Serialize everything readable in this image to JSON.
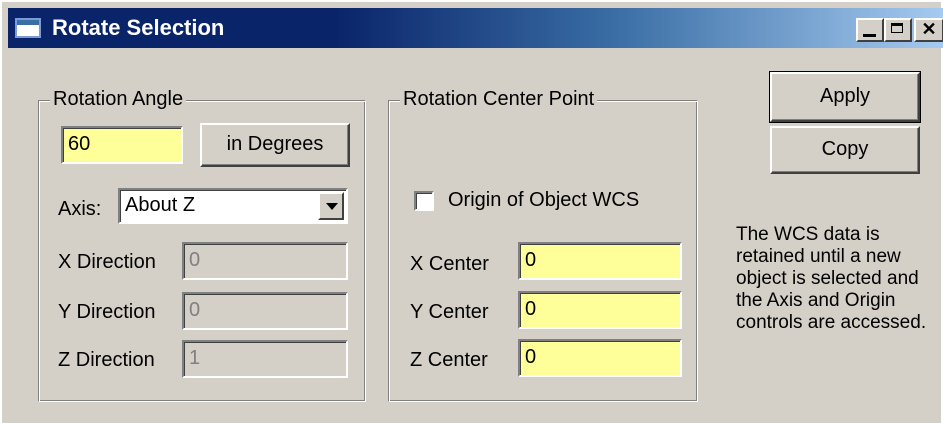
{
  "window": {
    "title": "Rotate Selection",
    "controls": [
      "minimize",
      "maximize",
      "close"
    ],
    "close_glyph": "✕"
  },
  "rotation_angle": {
    "legend": "Rotation Angle",
    "angle_value": "60",
    "units_button": "in Degrees",
    "axis_label": "Axis:",
    "axis_selected": "About Z",
    "x_direction_label": "X Direction",
    "x_direction_value": "0",
    "y_direction_label": "Y Direction",
    "y_direction_value": "0",
    "z_direction_label": "Z Direction",
    "z_direction_value": "1"
  },
  "rotation_center": {
    "legend": "Rotation Center Point",
    "origin_checkbox_label": "Origin of Object WCS",
    "origin_checked": false,
    "x_center_label": "X Center",
    "x_center_value": "0",
    "y_center_label": "Y Center",
    "y_center_value": "0",
    "z_center_label": "Z Center",
    "z_center_value": "0"
  },
  "actions": {
    "apply_label": "Apply",
    "copy_label": "Copy"
  },
  "note": "The WCS data is retained until a new object is selected and the Axis and Origin controls are accessed.",
  "colors": {
    "face": "#d4d0c8",
    "title_start": "#0a246a",
    "title_end": "#a6caf0",
    "input_highlight": "#ffff99"
  }
}
